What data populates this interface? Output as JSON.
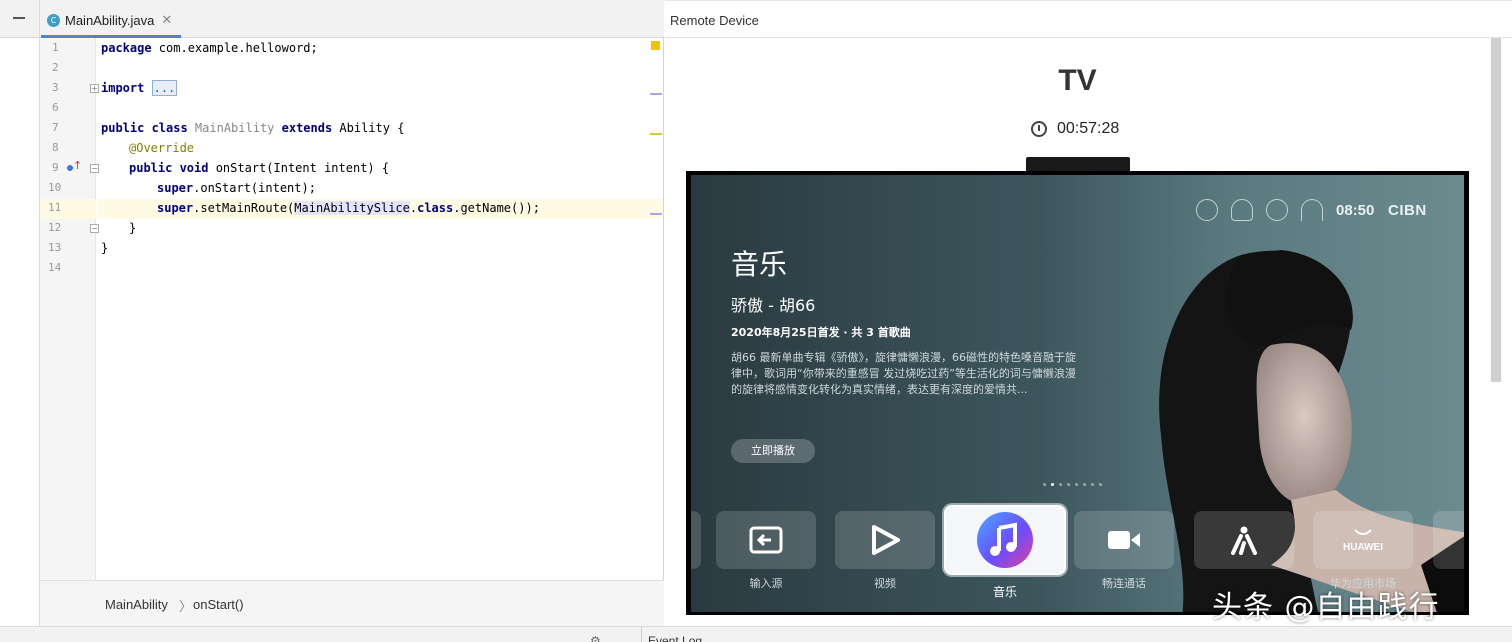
{
  "editor": {
    "tab_label": "MainAbility.java",
    "tab_icon": "C",
    "close_glyph": "✕",
    "lines": [
      {
        "num": "1"
      },
      {
        "num": "2"
      },
      {
        "num": "3"
      },
      {
        "num": "6"
      },
      {
        "num": "7"
      },
      {
        "num": "8"
      },
      {
        "num": "9"
      },
      {
        "num": "10"
      },
      {
        "num": "11"
      },
      {
        "num": "12"
      },
      {
        "num": "13"
      },
      {
        "num": "14"
      }
    ],
    "code": {
      "l1_kw": "package",
      "l1_rest": " com.example.helloword;",
      "l3_kw": "import",
      "l3_fold": "...",
      "l7_kw1": "public class",
      "l7_cls": " MainAbility ",
      "l7_kw2": "extends",
      "l7_rest": " Ability {",
      "l8_anno": "@Override",
      "l9_kw": "public void",
      "l9_rest": " onStart(Intent intent) {",
      "l10_kw": "super",
      "l10_rest": ".onStart(intent);",
      "l11_kw": "super",
      "l11_a": ".setMainRoute(",
      "l11_sel": "MainAbilitySlice",
      "l11_b": ".",
      "l11_kw2": "class",
      "l11_c": ".getName());",
      "l12": "}",
      "l13": "}"
    },
    "breadcrumb": {
      "class": "MainAbility",
      "sep": "〉",
      "method": "onStart()"
    }
  },
  "remote": {
    "title": "Remote Device",
    "device_name": "TV",
    "timer": "00:57:28",
    "tv": {
      "time": "08:50",
      "brand": "CIBN",
      "section_title": "音乐",
      "song": "骄傲 - 胡66",
      "release": "2020年8月25日首发 · 共 3 首歌曲",
      "description": "胡66 最新单曲专辑《骄傲》，旋律慵懒浪漫，66磁性的特色嗓音融于旋律中，歌词用“你带来的重感冒 发过烧吃过药”等生活化的词与慵懒浪漫的旋律将感情变化转化为真实情绪，表达更有深度的爱情共...",
      "play_button": "立即播放",
      "apps": [
        {
          "label": "输入源",
          "icon": "input-source-icon"
        },
        {
          "label": "视频",
          "icon": "video-play-icon"
        },
        {
          "label": "音乐",
          "icon": "music-note-icon"
        },
        {
          "label": "畅连通话",
          "icon": "video-call-icon"
        },
        {
          "label": "",
          "icon": "app-icon"
        },
        {
          "label": "华为应用市场",
          "icon": "huawei-appgallery-icon",
          "brand": "HUAWEI"
        }
      ],
      "carousel_count": 8,
      "carousel_active": 2
    }
  },
  "watermark": "头条 @自由践行",
  "bottom_bar": {
    "text": "Event Log"
  },
  "colors": {
    "keyword": "#000080",
    "annotation": "#808000",
    "tab_underline": "#4a88c7",
    "current_line": "#fffae3",
    "warning": "#f2c400"
  }
}
